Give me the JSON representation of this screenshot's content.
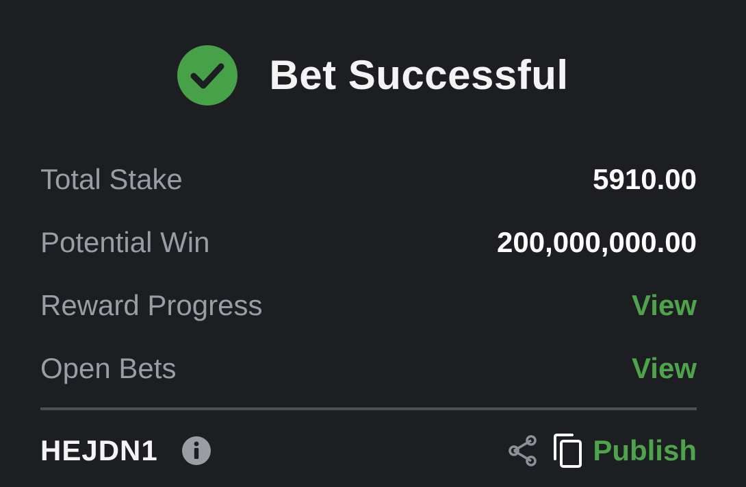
{
  "header": {
    "title": "Bet Successful",
    "icon": "check-circle-icon",
    "icon_color": "#46a148"
  },
  "summary": {
    "rows": [
      {
        "label": "Total Stake",
        "value": "5910.00",
        "type": "value"
      },
      {
        "label": "Potential Win",
        "value": "200,000,000.00",
        "type": "value"
      },
      {
        "label": "Reward Progress",
        "value": "View",
        "type": "link"
      },
      {
        "label": "Open Bets",
        "value": "View",
        "type": "link"
      }
    ]
  },
  "footer": {
    "booking_code": "HEJDN1",
    "info_icon": "info-icon",
    "share_icon": "share-icon",
    "copy_icon": "copy-icon",
    "publish_label": "Publish"
  },
  "colors": {
    "background": "#1d1e22",
    "accent_green": "#4fa44b",
    "label_gray": "#9b9da4",
    "text_white": "#ffffff"
  }
}
